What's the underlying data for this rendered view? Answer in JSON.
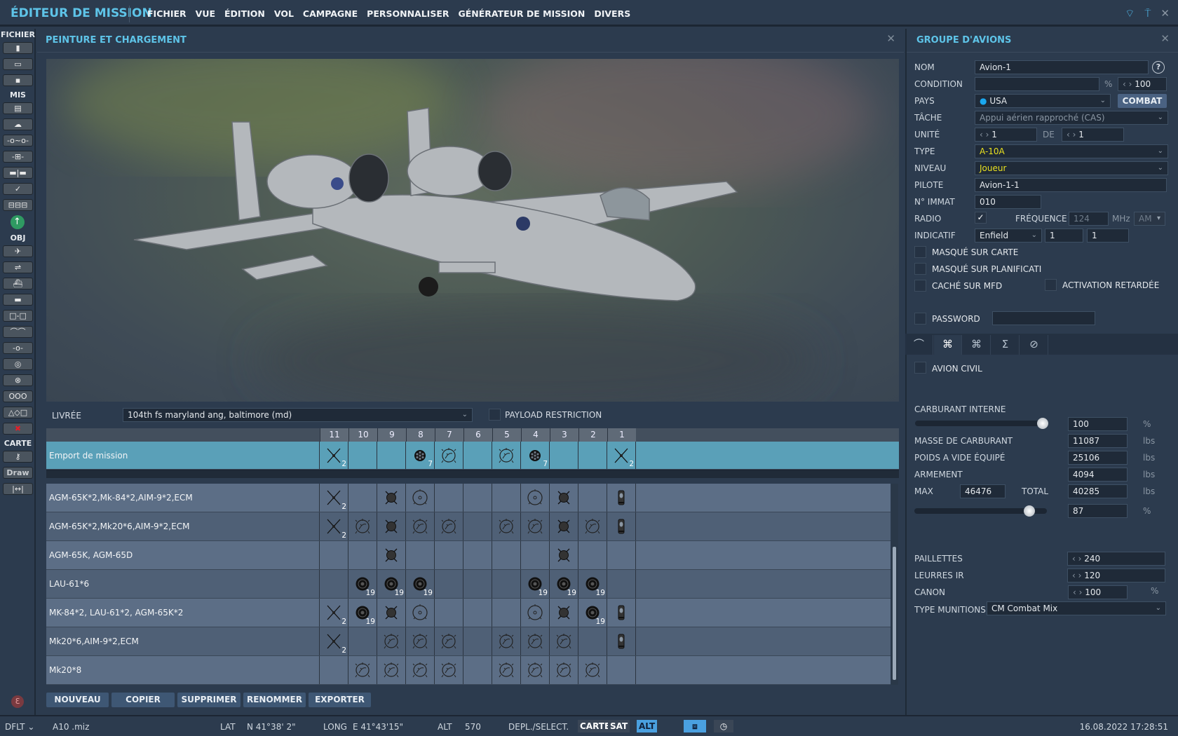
{
  "app": {
    "title": "ÉDITEUR DE MISSION",
    "menu": [
      "FICHIER",
      "VUE",
      "ÉDITION",
      "VOL",
      "CAMPAGNE",
      "PERSONNALISER",
      "GÉNÉRATEUR DE MISSION",
      "DIVERS"
    ],
    "top_icons": [
      "wifi-icon",
      "antenna-icon",
      "close-icon"
    ]
  },
  "sidebar": {
    "sections": [
      {
        "label": "FICHIER",
        "buttons": [
          {
            "icon": "new-file-icon",
            "glyph": "▮"
          },
          {
            "icon": "open-folder-icon",
            "glyph": "▭"
          },
          {
            "icon": "save-icon",
            "glyph": "▪"
          }
        ]
      },
      {
        "label": "MIS",
        "buttons": [
          {
            "icon": "clipboard-icon",
            "glyph": "▤"
          },
          {
            "icon": "weather-icon",
            "glyph": "☁"
          },
          {
            "icon": "trigger-zone-icon",
            "glyph": "-o~o-"
          },
          {
            "icon": "waypoint-icon",
            "glyph": "-⊞-"
          },
          {
            "icon": "flags-icon",
            "glyph": "▬|▬"
          },
          {
            "icon": "check-icon",
            "glyph": "✓"
          },
          {
            "icon": "triggers-icon",
            "glyph": "⊟⊟⊟"
          }
        ]
      },
      {
        "label": "",
        "green": "up-arrow-icon"
      },
      {
        "label": "OBJ",
        "buttons": [
          {
            "icon": "airplane-icon",
            "glyph": "✈"
          },
          {
            "icon": "helicopter-icon",
            "glyph": "⇌"
          },
          {
            "icon": "ship-icon",
            "glyph": "⛴"
          },
          {
            "icon": "tank-icon",
            "glyph": "▬"
          },
          {
            "icon": "static-objects-icon",
            "glyph": "□-□"
          },
          {
            "icon": "bridge-icon",
            "glyph": "⌒⌒"
          },
          {
            "icon": "node-icon",
            "glyph": "-o-"
          },
          {
            "icon": "target-icon",
            "glyph": "◎"
          },
          {
            "icon": "cancel-circle-icon",
            "glyph": "⊗"
          },
          {
            "icon": "rings-icon",
            "glyph": "OOO"
          },
          {
            "icon": "shapes-icon",
            "glyph": "△◇□"
          },
          {
            "icon": "delete-icon",
            "glyph": "✖",
            "color": "#e0202a"
          }
        ]
      },
      {
        "label": "CARTE",
        "buttons": [
          {
            "icon": "key-icon",
            "glyph": "⚷"
          },
          {
            "icon": "draw-icon",
            "glyph": "Draw"
          },
          {
            "icon": "ruler-icon",
            "glyph": "|↔|"
          }
        ]
      }
    ]
  },
  "loadout": {
    "title": "PEINTURE ET CHARGEMENT",
    "livery_label": "LIVRÉE",
    "livery_value": "104th fs maryland ang, baltimore (md)",
    "payload_restriction_label": "PAYLOAD RESTRICTION",
    "payload_restriction_checked": false,
    "pylons": [
      "11",
      "10",
      "9",
      "8",
      "7",
      "6",
      "5",
      "4",
      "3",
      "2",
      "1"
    ],
    "mission_row": {
      "name": "Emport de mission",
      "cells": [
        "cross:2",
        "",
        "",
        "rocket7:7",
        "mk20",
        "",
        "mk20",
        "rocket7:7",
        "",
        "",
        "cross:2"
      ]
    },
    "rows": [
      {
        "name": "AGM-65K*2,Mk-84*2,AIM-9*2,ECM",
        "cells": [
          "cross:2",
          "",
          "agm65",
          "mk84",
          "",
          "",
          "",
          "mk84",
          "agm65",
          "",
          "ecm"
        ]
      },
      {
        "name": "AGM-65K*2,Mk20*6,AIM-9*2,ECM",
        "cells": [
          "cross:2",
          "mk20",
          "agm65",
          "mk20",
          "mk20",
          "",
          "mk20",
          "mk20",
          "agm65",
          "mk20",
          "ecm"
        ]
      },
      {
        "name": "AGM-65K, AGM-65D",
        "cells": [
          "",
          "",
          "agm65",
          "",
          "",
          "",
          "",
          "",
          "agm65",
          "",
          ""
        ]
      },
      {
        "name": "LAU-61*6",
        "cells": [
          "",
          "lau61:19",
          "lau61:19",
          "lau61:19",
          "",
          "",
          "",
          "lau61:19",
          "lau61:19",
          "lau61:19",
          ""
        ]
      },
      {
        "name": "MK-84*2, LAU-61*2, AGM-65K*2",
        "cells": [
          "cross:2",
          "lau61:19",
          "agm65",
          "mk84",
          "",
          "",
          "",
          "mk84",
          "agm65",
          "lau61:19",
          "ecm"
        ]
      },
      {
        "name": "Mk20*6,AIM-9*2,ECM",
        "cells": [
          "cross:2",
          "",
          "mk20",
          "mk20",
          "mk20",
          "",
          "mk20",
          "mk20",
          "mk20",
          "",
          "ecm"
        ]
      },
      {
        "name": "Mk20*8",
        "cells": [
          "",
          "mk20",
          "mk20",
          "mk20",
          "mk20",
          "",
          "mk20",
          "mk20",
          "mk20",
          "mk20",
          ""
        ]
      }
    ],
    "buttons": [
      "NOUVEAU",
      "COPIER",
      "SUPPRIMER",
      "RENOMMER",
      "EXPORTER"
    ]
  },
  "group": {
    "title": "GROUPE D'AVIONS",
    "nom_label": "NOM",
    "nom": "Avion-1",
    "condition_label": "CONDITION",
    "condition_value": "",
    "condition_unit": "%",
    "condition_spin": "100",
    "pays_label": "PAYS",
    "pays": "USA",
    "pays_color": "#1aa8f0",
    "combat_label": "COMBAT",
    "tache_label": "TÂCHE",
    "tache": "Appui aérien rapproché (CAS)",
    "unite_label": "UNITÉ",
    "unite": "1",
    "de_label": "DE",
    "de": "1",
    "type_label": "TYPE",
    "type": "A-10A",
    "niveau_label": "NIVEAU",
    "niveau": "Joueur",
    "pilote_label": "PILOTE",
    "pilote": "Avion-1-1",
    "immat_label": "N° IMMAT",
    "immat": "010",
    "radio_label": "RADIO",
    "radio_checked": true,
    "freq_label": "FRÉQUENCE",
    "freq": "124",
    "freq_unit": "MHz",
    "modulation": "AM",
    "indicatif_label": "INDICATIF",
    "indicatif": "Enfield",
    "indicatif_1": "1",
    "indicatif_2": "1",
    "masque_carte": "MASQUÉ SUR CARTE",
    "masque_planif": "MASQUÉ SUR PLANIFICATI",
    "cache_mfd": "CACHÉ SUR MFD",
    "activation": "ACTIVATION RETARDÉE",
    "password_label": "PASSWORD",
    "password": "",
    "accent_yellow": "#e8e020"
  },
  "tabs": [
    {
      "icon": "route-icon",
      "glyph": "⌒"
    },
    {
      "icon": "payload-icon",
      "glyph": "⌘",
      "active": true
    },
    {
      "icon": "datalink-icon",
      "glyph": "⌘"
    },
    {
      "icon": "summary-icon",
      "glyph": "Σ"
    },
    {
      "icon": "forbidden-icon",
      "glyph": "⊘"
    }
  ],
  "fuel": {
    "avion_civil": "AVION CIVIL",
    "carburant_label": "CARBURANT INTERNE",
    "carburant_pct": "100",
    "pct": "%",
    "masse_label": "MASSE DE CARBURANT",
    "masse": "11087",
    "poids_label": "POIDS A VIDE ÉQUIPÉ",
    "poids": "25106",
    "armement_label": "ARMEMENT",
    "armement": "4094",
    "max_label": "MAX",
    "max": "46476",
    "total_label": "TOTAL",
    "total": "40285",
    "total_pct": "87",
    "lbs": "lbs",
    "paillettes_label": "PAILLETTES",
    "paillettes": "240",
    "leurres_label": "LEURRES IR",
    "leurres": "120",
    "canon_label": "CANON",
    "canon": "100",
    "munitions_label": "TYPE MUNITIONS",
    "munitions": "CM Combat Mix"
  },
  "status": {
    "profile": "DFLT",
    "file": "A10 .miz",
    "lat_label": "LAT",
    "lat": "N 41°38' 2\"",
    "long_label": "LONG",
    "long": "E 41°43'15\"",
    "alt_label": "ALT",
    "alt": "570",
    "depl": "DEPL./SELECT.",
    "carte": "CARTE",
    "sat": "SAT",
    "altb": "ALT",
    "datetime": "16.08.2022 17:28:51"
  }
}
